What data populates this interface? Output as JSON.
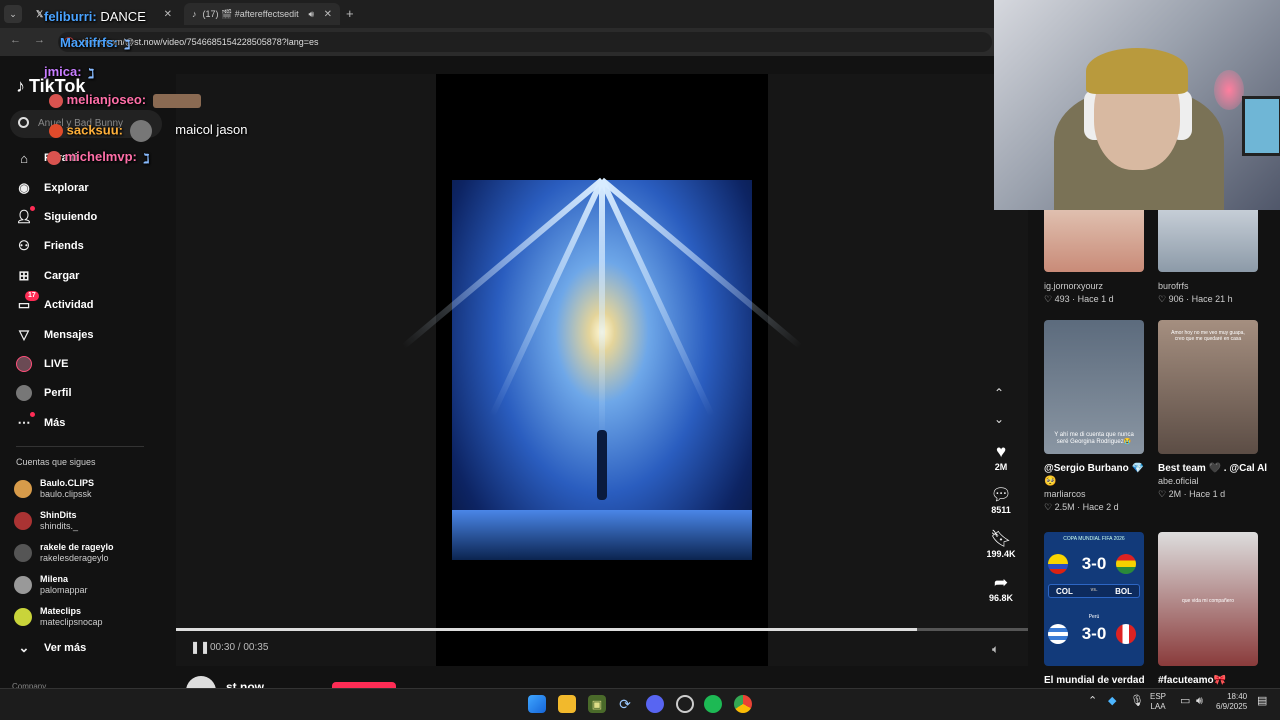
{
  "browser": {
    "tab1": {
      "title": "",
      "close": "✕"
    },
    "tab2": {
      "title": "(17) 🎬 #aftereffectsedit",
      "close": "✕"
    },
    "new_tab": "+",
    "url": "tiktok.com/@st.now/video/7546685154228505878?lang=es"
  },
  "sidebar": {
    "logo": "TikTok",
    "search_placeholder": "Anuel y Bad Bunny",
    "items": [
      {
        "label": "Para ti",
        "icon": "home-icon"
      },
      {
        "label": "Explorar",
        "icon": "compass-icon"
      },
      {
        "label": "Siguiendo",
        "icon": "following-icon"
      },
      {
        "label": "Friends",
        "icon": "friends-icon"
      },
      {
        "label": "Cargar",
        "icon": "upload-icon"
      },
      {
        "label": "Actividad",
        "icon": "inbox-icon",
        "badge": "17"
      },
      {
        "label": "Mensajes",
        "icon": "send-icon"
      },
      {
        "label": "LIVE",
        "icon": "live-icon"
      },
      {
        "label": "Perfil",
        "icon": "profile-icon"
      },
      {
        "label": "Más",
        "icon": "more-icon"
      }
    ],
    "following_header": "Cuentas que sigues",
    "following": [
      {
        "name": "Baulo.CLIPS",
        "handle": "baulo.clipssk"
      },
      {
        "name": "ShinDits",
        "handle": "shindits._"
      },
      {
        "name": "rakele de rageylo",
        "handle": "rakelesderageylo"
      },
      {
        "name": "Milena",
        "handle": "palomappar"
      },
      {
        "name": "Mateclips",
        "handle": "mateclipsnocap"
      }
    ],
    "see_more": "Ver más",
    "company": "Company"
  },
  "player": {
    "time": "00:30 / 00:35",
    "progress": 0.87,
    "author_name": "st.now"
  },
  "actions": [
    {
      "icon": "heart-icon",
      "value": "2M"
    },
    {
      "icon": "comment-icon",
      "value": "8511"
    },
    {
      "icon": "bookmark-icon",
      "value": "199.4K"
    },
    {
      "icon": "share-icon",
      "value": "96.8K"
    }
  ],
  "related": [
    {
      "title": "",
      "user": "ig.jornorxyourz",
      "stats": "♡ 493 · Hace 1 d"
    },
    {
      "title": "",
      "user": "burofrfs",
      "stats": "♡ 906 · Hace 21 h"
    },
    {
      "title": "@Sergio Burbano 💎 🥺",
      "user": "marliarcos",
      "stats": "♡ 2.5M · Hace 2 d",
      "overlay": "Y ahí me di cuenta que nunca seré Georgina Rodriguez😭"
    },
    {
      "title": "Best team 🖤 . @Cal Al",
      "user": "abe.oficial",
      "stats": "♡ 2M · Hace 1 d",
      "overlay": "Amor hoy no me veo muy guapa, creo que me quedaré en casa"
    },
    {
      "title": "El mundial de verdad",
      "user": "",
      "stats": "",
      "score1": "3-0",
      "score2": "3-0",
      "teams": "COL vs BOL",
      "team_a": "COL",
      "team_b": "BOL",
      "caption_small": "COPA MUNDIAL FIFA 2026",
      "country": "Perú"
    },
    {
      "title": "#facuteamo🎀",
      "user": "",
      "stats": "",
      "overlay": "que vida mi compañero"
    }
  ],
  "chat": [
    {
      "user": "feliburri:",
      "msg": "DANCE",
      "color": "#4aa3ff"
    },
    {
      "user": "Maxiifrfs:",
      "msg": "",
      "color": "#4aa3ff"
    },
    {
      "user": "jmica:",
      "msg": "",
      "color": "#c77dff"
    },
    {
      "user": "melianjoseo:",
      "msg": "",
      "color": "#ff6fa8"
    },
    {
      "user": "sacksuu:",
      "msg": "maicol jason",
      "color": "#ffb03a"
    },
    {
      "user": "michelmvp:",
      "msg": "",
      "color": "#ff6fa8"
    }
  ],
  "taskbar": {
    "lang": "ESP",
    "region": "LAA",
    "time": "18:40",
    "date": "6/9/2025"
  }
}
